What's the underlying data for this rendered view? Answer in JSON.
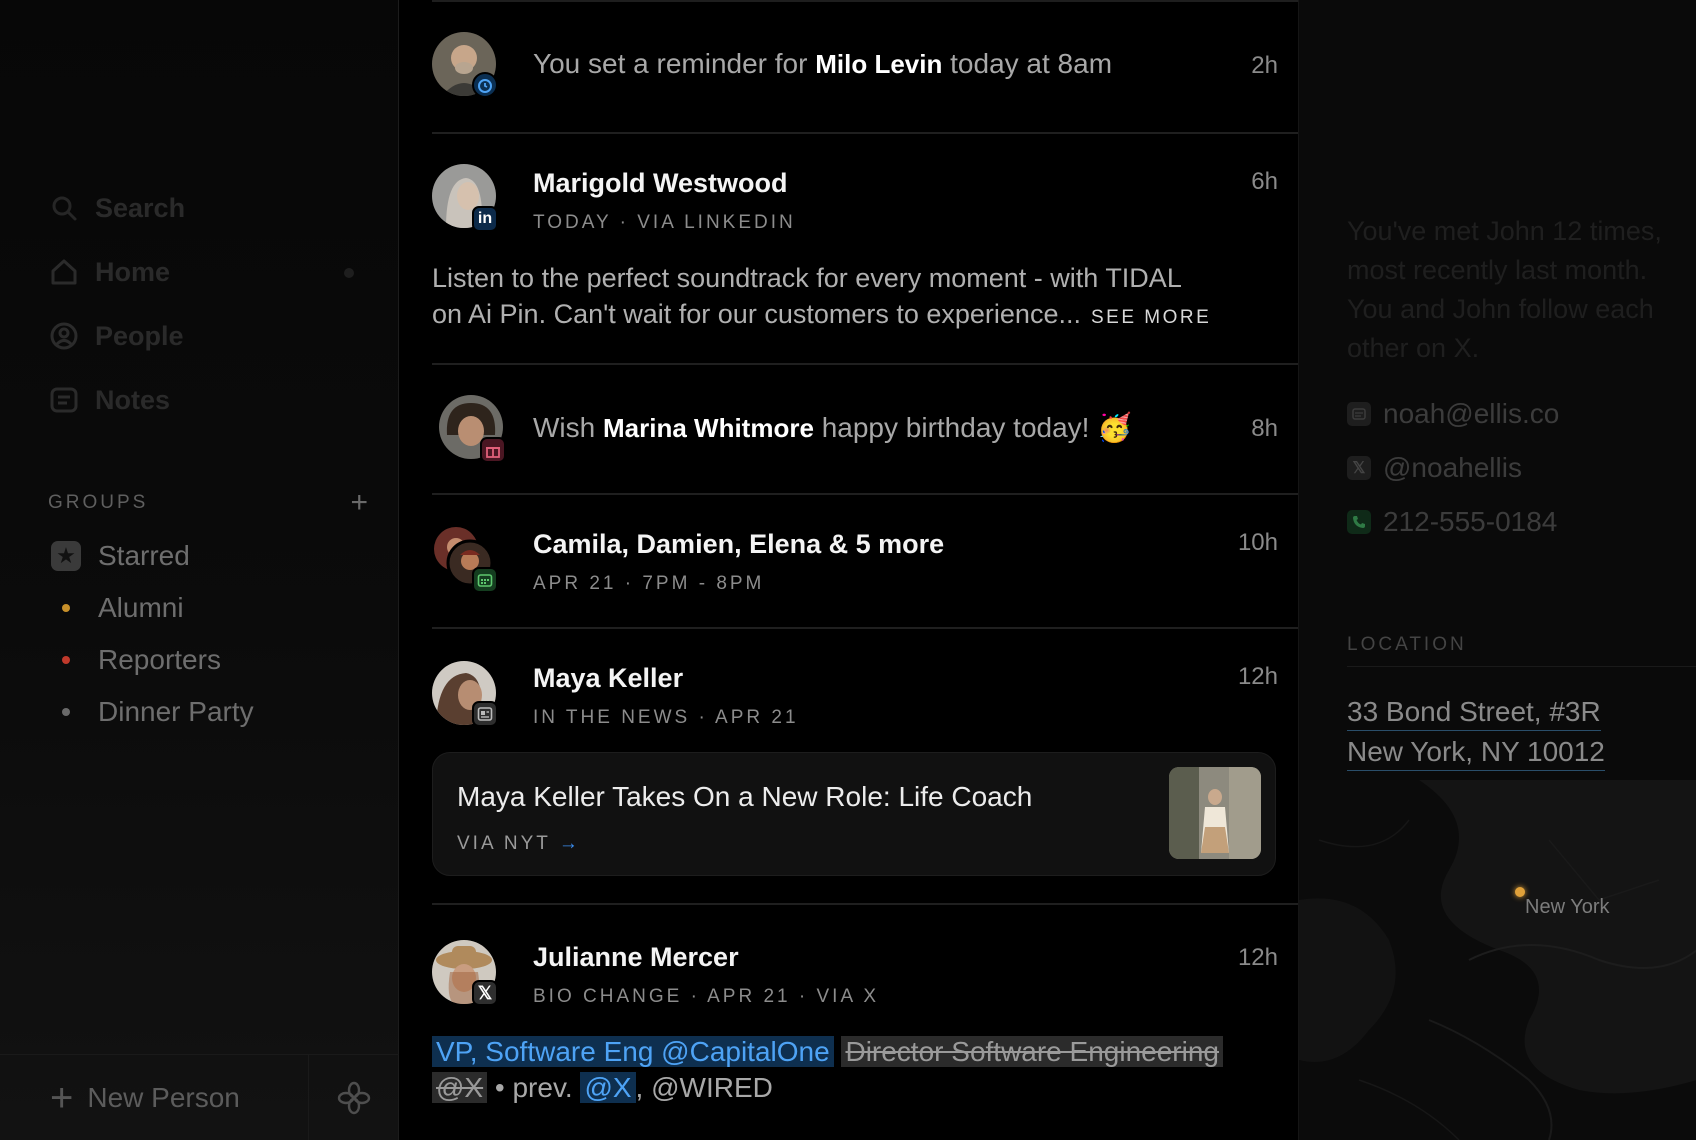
{
  "sidebar": {
    "nav": [
      {
        "label": "Search",
        "icon": "search-icon"
      },
      {
        "label": "Home",
        "icon": "home-icon"
      },
      {
        "label": "People",
        "icon": "person-icon"
      },
      {
        "label": "Notes",
        "icon": "notes-icon"
      }
    ],
    "groups_title": "GROUPS",
    "groups_add": "+",
    "groups": [
      {
        "label": "Starred",
        "color": "#3a3a3a"
      },
      {
        "label": "Alumni",
        "color": "#c8902a"
      },
      {
        "label": "Reporters",
        "color": "#c0392b"
      },
      {
        "label": "Dinner Party",
        "color": "#6a6a6a"
      }
    ],
    "new_person": "New Person"
  },
  "feed": {
    "reminder": {
      "prefix": "You set a reminder for",
      "name": "Milo Levin",
      "suffix": "today at 8am",
      "time": "2h"
    },
    "linkedin": {
      "name": "Marigold Westwood",
      "sub": "TODAY · VIA LINKEDIN",
      "time": "6h",
      "body_line1": "Listen to the perfect soundtrack for every moment - with TIDAL",
      "body_line2": "on Ai Pin. Can't wait for our customers to experience...",
      "see_more": "SEE MORE"
    },
    "birthday": {
      "prefix": "Wish",
      "name": "Marina Whitmore",
      "suffix": "happy birthday today!",
      "emoji": "🥳",
      "time": "8h"
    },
    "event": {
      "name": "Camila, Damien, Elena & 5 more",
      "sub": "APR 21 · 7PM - 8PM",
      "time": "10h"
    },
    "news": {
      "name": "Maya Keller",
      "sub": "IN THE NEWS · APR 21",
      "time": "12h",
      "card_title": "Maya Keller Takes On a New Role: Life Coach",
      "card_via": "VIA NYT",
      "arrow": "→"
    },
    "bio": {
      "name": "Julianne Mercer",
      "sub": "BIO CHANGE · APR 21 · VIA X",
      "time": "12h",
      "new_text": "VP, Software Eng @CapitalOne",
      "old_text": "Director Software Engineering",
      "old_handle": "@X",
      "sep": "• prev.",
      "new_handle": "@X",
      "tail": ", @WIRED"
    }
  },
  "right": {
    "summary_line1": "You've met John 12 times,",
    "summary_line2": "most recently last month.",
    "summary_line3": "You and John follow each",
    "summary_line4": "other on X.",
    "email": "noah@ellis.co",
    "x_handle": "@noahellis",
    "phone": "212-555-0184",
    "location_title": "LOCATION",
    "address_line1": "33 Bond Street, #3R",
    "address_line2": "New York, NY 10012",
    "map_label": "New York"
  },
  "colors": {
    "accent_blue": "#3a8df0",
    "map_pin": "#e0a13a"
  }
}
